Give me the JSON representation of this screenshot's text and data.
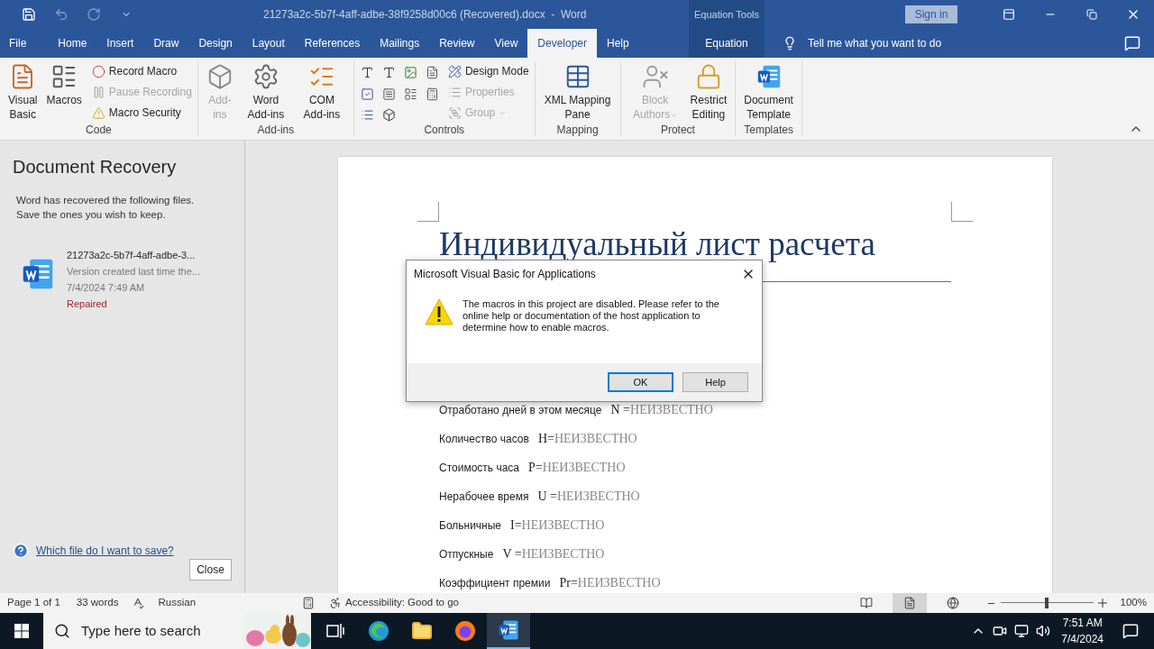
{
  "title_bar": {
    "quick_access": [
      {
        "kind": "save",
        "disabled": false
      },
      {
        "kind": "undo",
        "disabled": true
      },
      {
        "kind": "redo",
        "disabled": true
      },
      {
        "kind": "customize",
        "disabled": false
      }
    ],
    "document_title": "21273a2c-5b7f-4aff-adbe-38f9258d00c6 (Recovered).docx  -  Word",
    "contextual_group": "Equation Tools",
    "sign_in": "Sign in"
  },
  "tabs": [
    {
      "label": "File",
      "kind": "file",
      "selected": false
    },
    {
      "label": "Home",
      "kind": "tab",
      "selected": false
    },
    {
      "label": "Insert",
      "kind": "tab",
      "selected": false
    },
    {
      "label": "Draw",
      "kind": "tab",
      "selected": false
    },
    {
      "label": "Design",
      "kind": "tab",
      "selected": false
    },
    {
      "label": "Layout",
      "kind": "tab",
      "selected": false
    },
    {
      "label": "References",
      "kind": "tab",
      "selected": false
    },
    {
      "label": "Mailings",
      "kind": "tab",
      "selected": false
    },
    {
      "label": "Review",
      "kind": "tab",
      "selected": false
    },
    {
      "label": "View",
      "kind": "tab",
      "selected": false
    },
    {
      "label": "Developer",
      "kind": "tab",
      "selected": true
    },
    {
      "label": "Help",
      "kind": "tab",
      "selected": false
    },
    {
      "label": "Equation",
      "kind": "contextual",
      "selected": false
    }
  ],
  "tell_me": {
    "placeholder": "Tell me what you want to do"
  },
  "ribbon": [
    {
      "label": "Code",
      "items": [
        {
          "kind": "large",
          "label": "Visual Basic",
          "disabled": false
        },
        {
          "kind": "large",
          "label": "Macros",
          "disabled": false
        },
        {
          "kind": "column",
          "items": [
            {
              "label": "Record Macro",
              "disabled": false
            },
            {
              "label": "Pause Recording",
              "disabled": true
            },
            {
              "label": "Macro Security",
              "disabled": false
            }
          ]
        }
      ]
    },
    {
      "label": "Add-ins",
      "items": [
        {
          "kind": "large",
          "label": "Add-ins",
          "disabled": true
        },
        {
          "kind": "large",
          "label": "Word Add-ins",
          "disabled": false
        },
        {
          "kind": "large",
          "label": "COM Add-ins",
          "disabled": false
        }
      ]
    },
    {
      "label": "Controls",
      "items": [
        {
          "kind": "icon_grid"
        },
        {
          "kind": "column",
          "items": [
            {
              "label": "Design Mode",
              "disabled": false
            },
            {
              "label": "Properties",
              "disabled": true
            },
            {
              "label": "Group",
              "disabled": true,
              "has_menu": true
            }
          ]
        }
      ]
    },
    {
      "label": "Mapping",
      "items": [
        {
          "kind": "large",
          "label": "XML Mapping Pane",
          "disabled": false
        }
      ]
    },
    {
      "label": "Protect",
      "items": [
        {
          "kind": "large",
          "label": "Block Authors",
          "disabled": true,
          "has_menu": true
        },
        {
          "kind": "large",
          "label": "Restrict Editing",
          "disabled": false
        }
      ]
    },
    {
      "label": "Templates",
      "items": [
        {
          "kind": "large",
          "label": "Document Template",
          "disabled": false
        }
      ]
    }
  ],
  "recovery": {
    "title": "Document Recovery",
    "description": "Word has recovered the following files.  Save the ones you wish to keep.",
    "files": [
      {
        "name": "21273a2c-5b7f-4aff-adbe-3...",
        "detail": "Version created last time the...",
        "date": "7/4/2024 7:49 AM",
        "status": "Repaired"
      }
    ],
    "help_link": "Which file do I want to save?",
    "close": "Close"
  },
  "document": {
    "title": "Индивидуальный лист расчета",
    "lines": [
      {
        "label": "Отработано дней в этом месяце",
        "variable": "N =",
        "value": "НЕИЗВЕСТНО"
      },
      {
        "label": "Количество часов",
        "variable": "H=",
        "value": "НЕИЗВЕСТНО"
      },
      {
        "label": "Стоимость часа",
        "variable": "P=",
        "value": "НЕИЗВЕСТНО"
      },
      {
        "label": "Нерабочее время",
        "variable": "U =",
        "value": "НЕИЗВЕСТНО"
      },
      {
        "label": "Больничные",
        "variable": "I=",
        "value": "НЕИЗВЕСТНО"
      },
      {
        "label": "Отпускные",
        "variable": "V =",
        "value": "НЕИЗВЕСТНО"
      },
      {
        "label": "Коэффициент премии",
        "variable": "Pr=",
        "value": "НЕИЗВЕСТНО"
      }
    ]
  },
  "dialog": {
    "title": "Microsoft Visual Basic for Applications",
    "message": "The macros in this project are disabled.  Please refer to the online help or documentation of the host application to determine how to enable macros.",
    "buttons": [
      {
        "label": "OK",
        "selected": true
      },
      {
        "label": "Help",
        "selected": false
      }
    ]
  },
  "status_bar": {
    "page": "Page 1 of 1",
    "words": "33 words",
    "language": "Russian",
    "accessibility": "Accessibility: Good to go",
    "views": [
      {
        "kind": "read",
        "selected": false
      },
      {
        "kind": "print",
        "selected": true
      },
      {
        "kind": "web",
        "selected": false
      }
    ],
    "zoom": {
      "level": 0.5,
      "reading": "100%"
    }
  },
  "taskbar": {
    "search_placeholder": "Type here to search",
    "apps": [
      {
        "kind": "task_view",
        "selected": false
      },
      {
        "kind": "edge",
        "selected": false
      },
      {
        "kind": "explorer",
        "selected": false
      },
      {
        "kind": "firefox",
        "selected": false
      },
      {
        "kind": "word",
        "selected": true
      }
    ],
    "time": "7:51 AM",
    "date": "7/4/2024"
  }
}
